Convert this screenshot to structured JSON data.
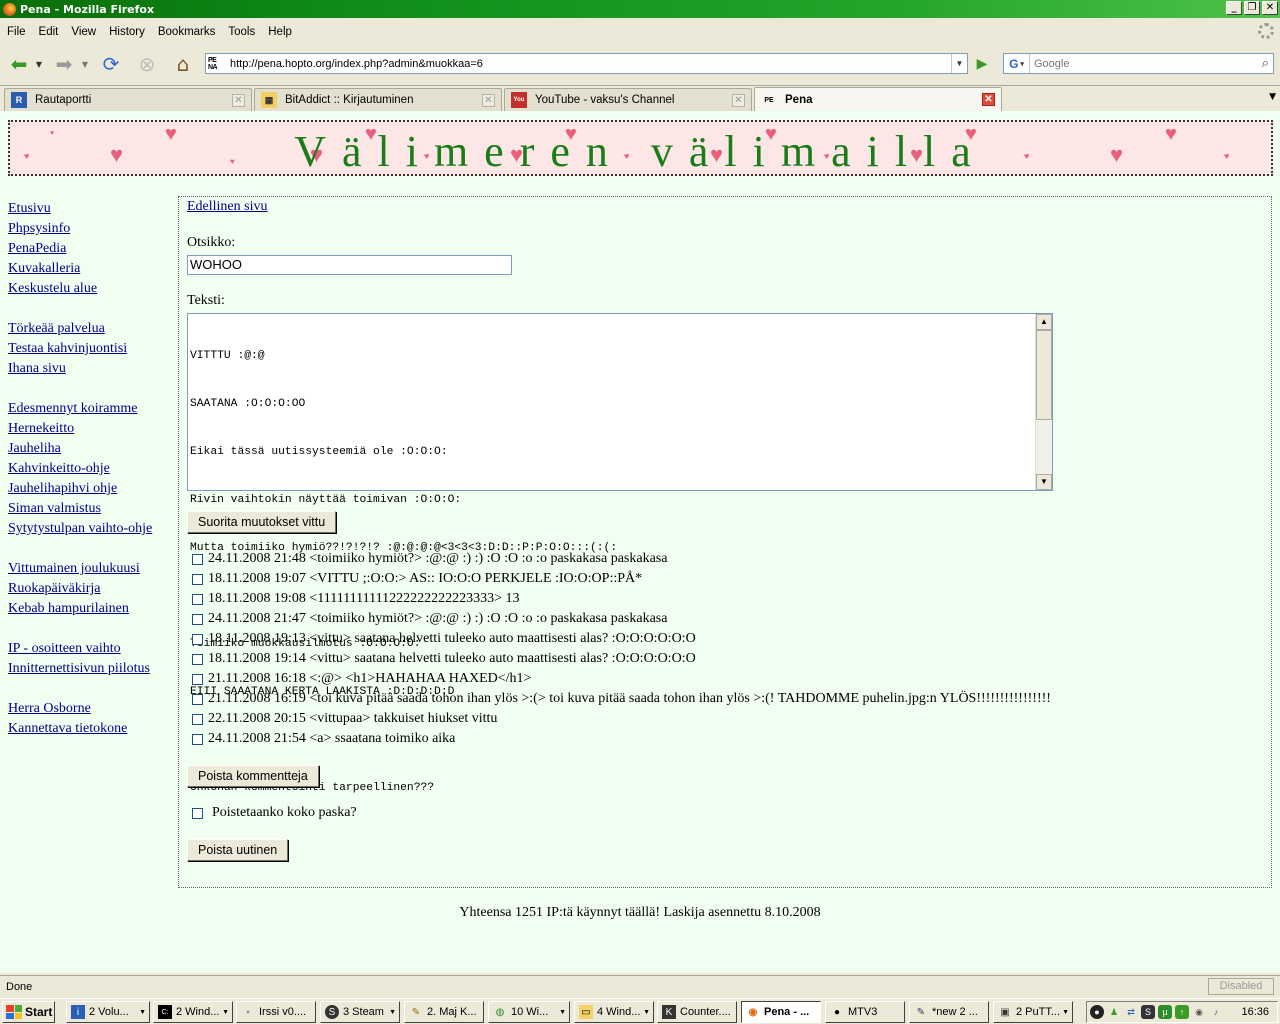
{
  "window": {
    "title": "Pena - Mozilla Firefox"
  },
  "menu": [
    "File",
    "Edit",
    "View",
    "History",
    "Bookmarks",
    "Tools",
    "Help"
  ],
  "nav": {
    "url": "http://pena.hopto.org/index.php?admin&muokkaa=6",
    "search_placeholder": "Google",
    "favicon_text": "PE NA"
  },
  "tabs": [
    {
      "label": "Rautaportti",
      "icon": "R"
    },
    {
      "label": "BitAddict :: Kirjautuminen",
      "icon": "▦"
    },
    {
      "label": "YouTube - vaksu's Channel",
      "icon": "You"
    },
    {
      "label": "Pena",
      "icon": "PE"
    }
  ],
  "page": {
    "banner_title": "Välimeren välimailla",
    "sidebar_groups": [
      [
        "Etusivu",
        "Phpsysinfo",
        "PenaPedia",
        "Kuvakalleria",
        "Keskustelu alue"
      ],
      [
        "Törkeää palvelua",
        "Testaa kahvinjuontisi",
        "Ihana sivu"
      ],
      [
        "Edesmennyt koiramme",
        "Hernekeitto",
        "Jauheliha",
        "Kahvinkeitto-ohje",
        "Jauhelihapihvi ohje",
        "Siman valmistus",
        "Sytytystulpan vaihto-ohje",
        "Vittumainen joulukuusi",
        "Ruokapäiväkirja",
        "Kebab hampurilainen"
      ],
      [
        "IP - osoitteen vaihto",
        "Innitternettisivun piilotus"
      ],
      [
        "Herra Osborne",
        "Kannettava tietokone"
      ]
    ],
    "prev_link": "Edellinen sivu",
    "title_label": "Otsikko:",
    "title_value": "WOHOO",
    "text_label": "Teksti:",
    "text_lines": [
      "VITTTU :@:@",
      "SAATANA :O:O:O:OO",
      "Eikai tässä uutissysteemiä ole :O:O:O:",
      "Rivin vaihtokin näyttää toimivan :O:O:O:",
      "Mutta toimiiko hymiö??!?!?!? :@:@:@:@<3<3<3:D:D::P:P:O:O:::(:(:",
      "",
      "Toimiiko muokkausilmotus :O:O:O:O:",
      "EIII SAAATANA KERTA LAAKISTA :D:D:D:D:D",
      "",
      "onkohan kommentointi tarpeellinen???"
    ],
    "save_button": "Suorita muutokset vittu",
    "comments": [
      "24.11.2008 21:48 <toimiiko hymiöt?> :@:@ :) :) :O :O :o :o paskakasa paskakasa",
      "18.11.2008 19:07 <VITTU ;:O:O:> AS:: IO:O:O PERKJELE :IO:O:OP::PÅ*",
      "18.11.2008 19:08 <11111111111222222222223333> 13",
      "24.11.2008 21:47 <toimiiko hymiöt?> :@:@ :) :) :O :O :o :o paskakasa paskakasa",
      "18.11.2008 19:13 <vittu> saatana helvetti tuleeko auto maattisesti alas? :O:O:O:O:O:O",
      "18.11.2008 19:14 <vittu> saatana helvetti tuleeko auto maattisesti alas? :O:O:O:O:O:O",
      "21.11.2008 16:18 <:@> <h1>HAHAHAA HAXED</h1>",
      "21.11.2008 16:19 <toi kuva pitää saada tohon ihan ylös >:(> toi kuva pitää saada tohon ihan ylös >:(! TAHDOMME puhelin.jpg:n YLÖS!!!!!!!!!!!!!!!!",
      "22.11.2008 20:15 <vittupaa> takkuiset hiukset vittu",
      "24.11.2008 21:54 <a> ssaatana toimiko aika"
    ],
    "delete_comments_button": "Poista kommentteja",
    "delete_all_label": "Poistetaanko koko paska?",
    "delete_news_button": "Poista uutinen",
    "footer": "Yhteensa 1251 IP:tä käynnyt täällä! Laskija asennettu 8.10.2008"
  },
  "status": {
    "text": "Done",
    "right": "Disabled"
  },
  "taskbar": {
    "start": "Start",
    "tasks": [
      {
        "label": "2 Volu...",
        "icon": "i"
      },
      {
        "label": "2 Wind...",
        "icon": "C:"
      },
      {
        "label": "Irssi v0....",
        "icon": "◦"
      },
      {
        "label": "3 Steam",
        "icon": "S"
      },
      {
        "label": "2. Maj K...",
        "icon": "✎"
      },
      {
        "label": "10 Wi...",
        "icon": "◍"
      },
      {
        "label": "4 Wind...",
        "icon": "▭"
      },
      {
        "label": "Counter....",
        "icon": "K"
      },
      {
        "label": "Pena - ...",
        "icon": "◉"
      },
      {
        "label": "MTV3",
        "icon": "●"
      },
      {
        "label": "*new 2 ...",
        "icon": "✎"
      },
      {
        "label": "2 PuTT...",
        "icon": "▣"
      }
    ],
    "clock": "16:36"
  }
}
